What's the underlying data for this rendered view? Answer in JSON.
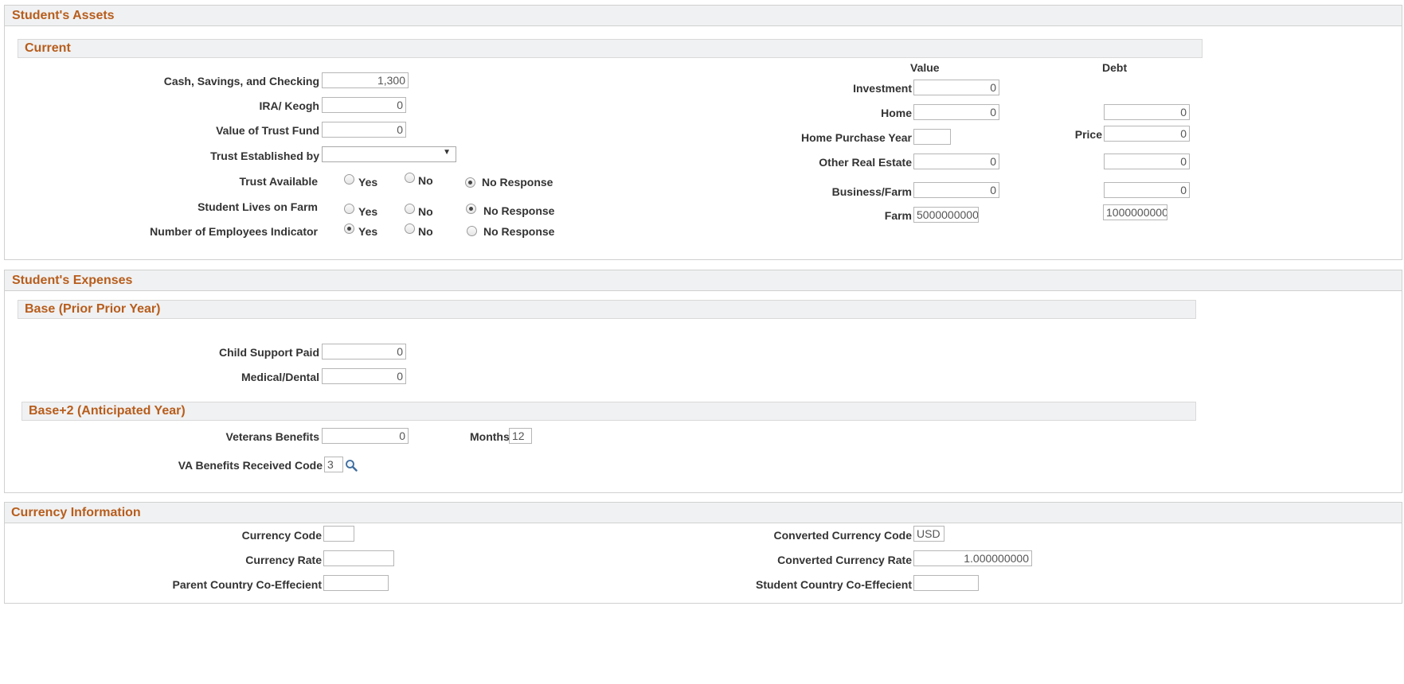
{
  "assets": {
    "title": "Student's Assets",
    "current_title": "Current",
    "cash": {
      "label": "Cash, Savings, and Checking",
      "value": "1,300"
    },
    "ira": {
      "label": "IRA/ Keogh",
      "value": "0"
    },
    "trust_fund": {
      "label": "Value of Trust Fund",
      "value": "0"
    },
    "trust_established": {
      "label": "Trust Established by",
      "value": ""
    },
    "trust_available": {
      "label": "Trust Available",
      "options": [
        "Yes",
        "No",
        "No Response"
      ],
      "selected": "No Response"
    },
    "lives_on_farm": {
      "label": "Student Lives on Farm",
      "options": [
        "Yes",
        "No",
        "No Response"
      ],
      "selected": "No Response"
    },
    "employees_indicator": {
      "label": "Number of Employees Indicator",
      "options": [
        "Yes",
        "No",
        "No Response"
      ],
      "selected": "Yes"
    },
    "value_header": "Value",
    "debt_header": "Debt",
    "investment": {
      "label": "Investment",
      "value": "0"
    },
    "home": {
      "label": "Home",
      "value": "0",
      "debt": "0"
    },
    "home_purchase_year": {
      "label": "Home Purchase Year",
      "value": ""
    },
    "price": {
      "label": "Price",
      "value": "0"
    },
    "other_real_estate": {
      "label": "Other Real Estate",
      "value": "0",
      "debt": "0"
    },
    "business_farm": {
      "label": "Business/Farm",
      "value": "0",
      "debt": "0"
    },
    "farm": {
      "label": "Farm",
      "value": "5000000000",
      "debt": "1000000000"
    }
  },
  "expenses": {
    "title": "Student's Expenses",
    "base_title": "Base (Prior Prior Year)",
    "child_support": {
      "label": "Child Support Paid",
      "value": "0"
    },
    "medical": {
      "label": "Medical/Dental",
      "value": "0"
    },
    "base2_title": "Base+2 (Anticipated Year)",
    "veterans": {
      "label": "Veterans Benefits",
      "value": "0"
    },
    "months": {
      "label": "Months",
      "value": "12"
    },
    "va_code": {
      "label": "VA Benefits Received Code",
      "value": "3"
    }
  },
  "currency": {
    "title": "Currency Information",
    "code": {
      "label": "Currency Code",
      "value": ""
    },
    "rate": {
      "label": "Currency Rate",
      "value": ""
    },
    "parent_coeff": {
      "label": "Parent Country Co-Effecient",
      "value": ""
    },
    "conv_code": {
      "label": "Converted Currency Code",
      "value": "USD"
    },
    "conv_rate": {
      "label": "Converted Currency Rate",
      "value": "1.000000000"
    },
    "student_coeff": {
      "label": "Student Country Co-Effecient",
      "value": ""
    }
  }
}
